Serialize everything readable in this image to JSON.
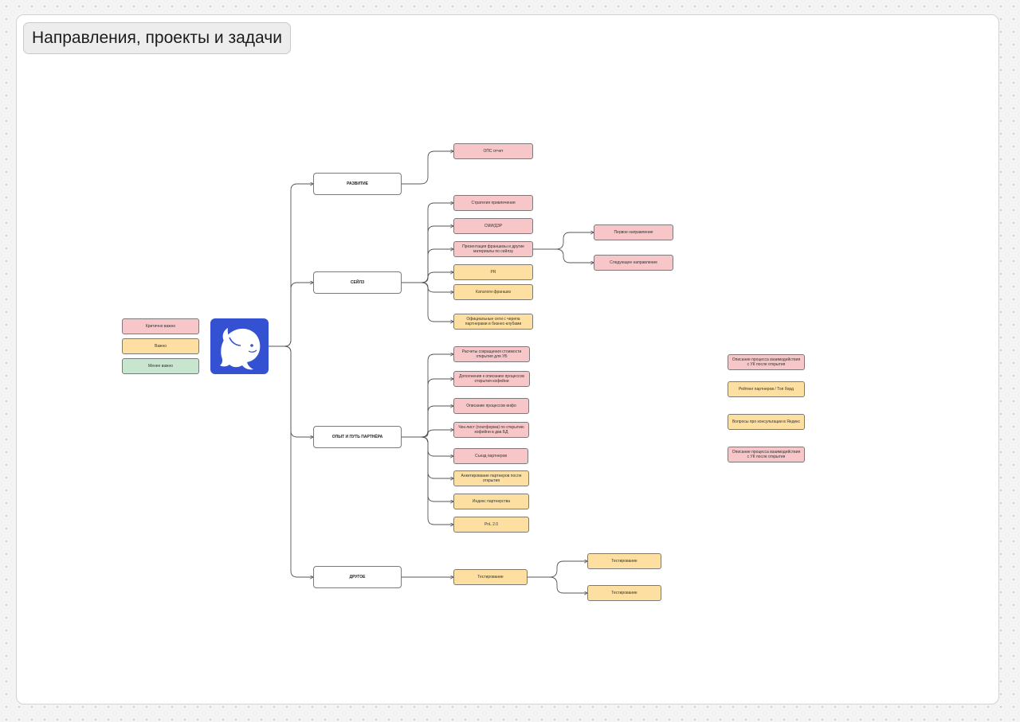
{
  "board": {
    "title": "Направления, проекты и задачи"
  },
  "legend": {
    "critical": "Критично важно",
    "important": "Важно",
    "less": "Менее важно"
  },
  "colors": {
    "critical": "#f7c6c8",
    "important": "#fde0a1",
    "less": "#c8e6cf",
    "logo": "#3451d1"
  },
  "logo": {
    "icon": "beluga-whale-icon"
  },
  "branches": {
    "razvitie": "РАЗВИТИЕ",
    "seyls": "СЕЙЛЗ",
    "opyt": "ОПЫТ И ПУТЬ ПАРТНЁРА",
    "drugoe": "ДРУГОЕ"
  },
  "razvitie": {
    "ops": "ОПС отчет"
  },
  "seyls": {
    "strategy": "Стратегия привлечения",
    "smm": "СМИ/ДЗР",
    "presentation": "Презентация франшизы и другие материалы по сейлзу",
    "pr": "PR",
    "catalogs": "Каталоги франшиз",
    "official": "Официальные сети с черепа партнерами и бизнес-клубами",
    "first_direction": "Первое направление",
    "next_direction": "Следующее направление"
  },
  "opyt": {
    "calc": "Расчеты сокращения стоимости открытия для УБ",
    "additions": "Дополнения к описанию процессов открытия кофейни",
    "describe": "Описание процессов инфо",
    "checklist": "Чек-лист (платформа) по открытию кофейни в два БД",
    "meeting": "Съезд партнеров",
    "survey": "Анкетирование партнеров после открытия",
    "index": "Индекс партнерства",
    "pnl": "PnL 2.0"
  },
  "drugoe": {
    "testing": "Тестирование",
    "testing_a": "Тестирование",
    "testing_b": "Тестирование"
  },
  "floating": {
    "f1": "Описание процесса взаимодействия с УК после открытия",
    "f2": "Рейтинг партнеров / Топ борд",
    "f3": "Вопросы про консультации в Яндекс",
    "f4": "Описание процесса взаимодействия с УК после открытия"
  }
}
